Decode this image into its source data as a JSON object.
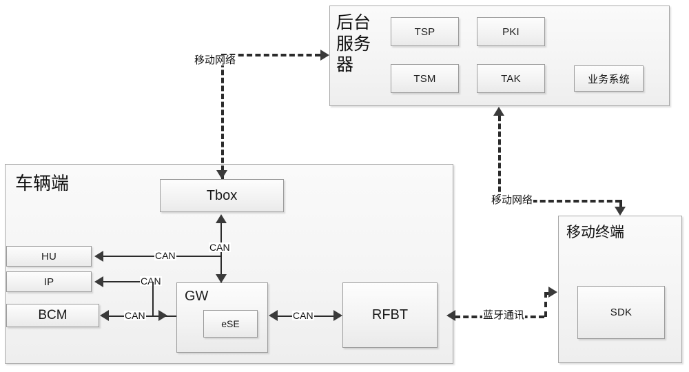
{
  "diagram": {
    "title_visible": false,
    "zones": {
      "backend_server": {
        "label": "后台\n服务\n器",
        "modules": [
          {
            "id": "tsp",
            "label": "TSP"
          },
          {
            "id": "pki",
            "label": "PKI"
          },
          {
            "id": "tsm",
            "label": "TSM"
          },
          {
            "id": "tak",
            "label": "TAK"
          },
          {
            "id": "business_system",
            "label": "业务系统"
          }
        ]
      },
      "vehicle": {
        "label": "车辆端",
        "modules": [
          {
            "id": "tbox",
            "label": "Tbox"
          },
          {
            "id": "hu",
            "label": "HU"
          },
          {
            "id": "ip",
            "label": "IP"
          },
          {
            "id": "bcm",
            "label": "BCM"
          },
          {
            "id": "gw",
            "label": "GW"
          },
          {
            "id": "ese",
            "label": "eSE"
          },
          {
            "id": "rfbt",
            "label": "RFBT"
          }
        ]
      },
      "mobile_terminal": {
        "label": "移动终端",
        "modules": [
          {
            "id": "sdk",
            "label": "SDK"
          }
        ]
      }
    },
    "edge_labels": {
      "mobile_network_tbox": "移动网络",
      "mobile_network_terminal": "移动网络",
      "bluetooth": "蓝牙通讯",
      "can_tbox_gw": "CAN",
      "can_hu": "CAN",
      "can_ip": "CAN",
      "can_bcm": "CAN",
      "can_gw_rfbt": "CAN"
    },
    "colors": {
      "line": "#2b2b2b",
      "box_border": "#9a9a9a",
      "box_fill_top": "#fdfdfd",
      "box_fill_bottom": "#eaeaea",
      "text": "#1a1a1a",
      "background": "#ffffff"
    }
  }
}
